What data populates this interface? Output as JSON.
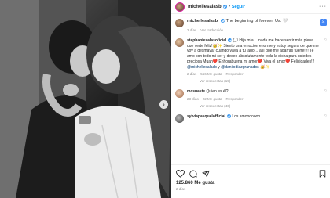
{
  "post": {
    "username": "michellesalasb",
    "follow_label": "Seguir",
    "caption_text": "The beginning of forever. Us.",
    "caption_emoji": "🤍",
    "caption_time": "2 días",
    "see_translation": "Ver traducción"
  },
  "comments": [
    {
      "username": "stephaniesalasoficial",
      "text": "💭 Hija mía… nada me hace sentir más plena que verte feliz!🥳✨ Siento una emoción enorme y estoy segura de que me voy a desmayar cuando vaya a tu lado… así que me agarrás fuerte!!!! Te amo con todo mi ser y deseo absolutamente toda la dicha para ustedes preciosa Muah❤️ Enhorabuena mi amor❤️ Viva el amor❤️ Felicidades!!!",
      "mention_1": "@michellesalasb",
      "connector": " y ",
      "mention_2": "@danilodiazgranados",
      "tail": " 🥳✨",
      "time": "2 días",
      "likes": "566 Me gusta",
      "reply": "Responder",
      "replies": "Ver respuestas (19)"
    },
    {
      "username": "mcsuaste",
      "text": "Quien es él?",
      "time": "23 días",
      "likes": "22 Me gusta",
      "reply": "Responder",
      "replies": "Ver respuestas (46)"
    },
    {
      "username": "sylviapasquelofficial",
      "text": "Los amooooooo"
    }
  ],
  "actions": {
    "likes": "125.860 Me gusta",
    "date": "2 días"
  },
  "icons": [
    "heart-icon",
    "comment-icon",
    "share-icon",
    "save-icon",
    "more-options-icon",
    "translate-icon",
    "carousel-next-icon"
  ]
}
